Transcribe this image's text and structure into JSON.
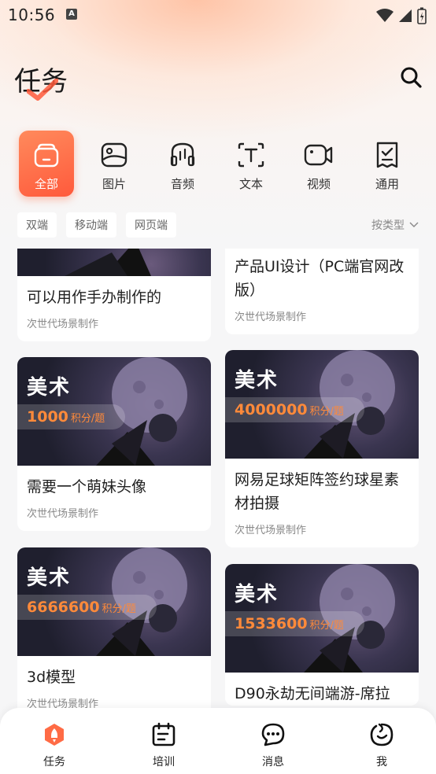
{
  "status": {
    "time": "10:56",
    "badge": "A"
  },
  "header": {
    "title": "任务"
  },
  "categories": [
    {
      "label": "全部",
      "icon": "box-icon",
      "active": true
    },
    {
      "label": "图片",
      "icon": "image-icon"
    },
    {
      "label": "音频",
      "icon": "audio-icon"
    },
    {
      "label": "文本",
      "icon": "text-icon"
    },
    {
      "label": "视频",
      "icon": "video-icon"
    },
    {
      "label": "通用",
      "icon": "document-icon"
    }
  ],
  "filters": [
    "双端",
    "移动端",
    "网页端"
  ],
  "sort": {
    "label": "按类型"
  },
  "cards": {
    "left": [
      {
        "title": "可以用作手办制作的",
        "subtitle": "次世代场景制作"
      },
      {
        "tag": "美术",
        "reward": "1000",
        "unit": "积分/题",
        "title": "需要一个萌妹头像",
        "subtitle": "次世代场景制作"
      },
      {
        "tag": "美术",
        "reward": "6666600",
        "unit": "积分/题",
        "title": "3d模型",
        "subtitle": "次世代场景制作"
      }
    ],
    "right": [
      {
        "title": "产品UI设计（PC端官网改版）",
        "subtitle": "次世代场景制作"
      },
      {
        "tag": "美术",
        "reward": "4000000",
        "unit": "积分/题",
        "title": "网易足球矩阵签约球星素材拍摄",
        "subtitle": "次世代场景制作"
      },
      {
        "tag": "美术",
        "reward": "1533600",
        "unit": "积分/题",
        "title": "D90永劫无间端游-席拉",
        "subtitle": ""
      }
    ]
  },
  "tabbar": [
    {
      "label": "任务",
      "icon": "rocket-icon",
      "active": true
    },
    {
      "label": "培训",
      "icon": "training-icon"
    },
    {
      "label": "消息",
      "icon": "message-icon"
    },
    {
      "label": "我",
      "icon": "profile-icon"
    }
  ],
  "colors": {
    "accent": "#ff6b45",
    "reward": "#ff8a3a"
  }
}
